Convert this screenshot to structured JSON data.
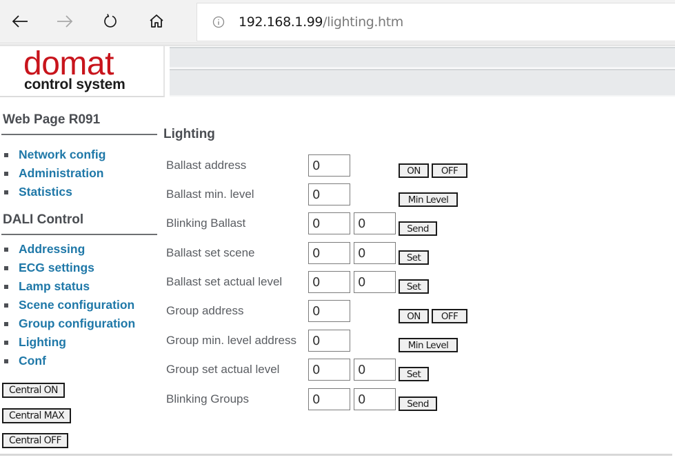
{
  "browser": {
    "url_host": "192.168.1.99",
    "url_path": "/lighting.htm",
    "icons": {
      "back": "arrow-left-icon",
      "forward": "arrow-right-icon",
      "refresh": "refresh-icon",
      "home": "home-icon",
      "info": "info-icon"
    }
  },
  "header": {
    "logo_main": "domat",
    "logo_sub": "control system",
    "brand_color": "#c8141c"
  },
  "sidebar": {
    "section1_title": "Web Page R091",
    "section1_items": [
      "Network config",
      "Administration",
      "Statistics"
    ],
    "section2_title": "DALI Control",
    "section2_items": [
      "Addressing",
      "ECG settings",
      "Lamp status",
      "Scene configuration",
      "Group configuration",
      "Lighting",
      "Conf"
    ],
    "buttons": [
      "Central ON",
      "Central MAX",
      "Central OFF"
    ],
    "link_color": "#1f78a8"
  },
  "main": {
    "title": "Lighting",
    "rows": [
      {
        "label": "Ballast address",
        "values": [
          "0"
        ],
        "buttons": [
          "ON",
          "OFF"
        ]
      },
      {
        "label": "Ballast min. level",
        "values": [
          "0"
        ],
        "buttons": [
          "Min Level"
        ]
      },
      {
        "label": "Blinking Ballast",
        "values": [
          "0",
          "0"
        ],
        "buttons": [
          "Send"
        ]
      },
      {
        "label": "Ballast set scene",
        "values": [
          "0",
          "0"
        ],
        "buttons": [
          "Set"
        ]
      },
      {
        "label": "Ballast set actual level",
        "values": [
          "0",
          "0"
        ],
        "buttons": [
          "Set"
        ]
      },
      {
        "label": "Group address",
        "values": [
          "0"
        ],
        "buttons": [
          "ON",
          "OFF"
        ]
      },
      {
        "label": "Group min. level address",
        "values": [
          "0"
        ],
        "buttons": [
          "Min Level"
        ]
      },
      {
        "label": "Group set actual level",
        "values": [
          "0",
          "0"
        ],
        "buttons": [
          "Set"
        ]
      },
      {
        "label": "Blinking Groups",
        "values": [
          "0",
          "0"
        ],
        "buttons": [
          "Send"
        ]
      }
    ]
  }
}
